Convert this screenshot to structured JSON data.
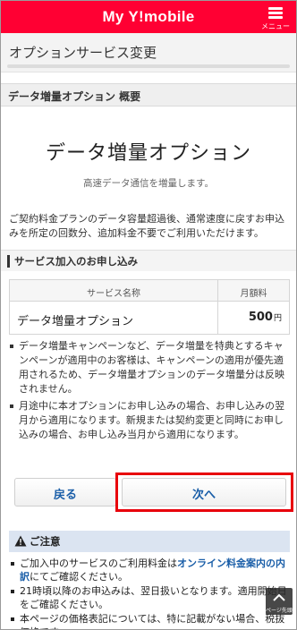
{
  "header": {
    "logo": "My Y!mobile",
    "menu_label": "メニュー"
  },
  "page": {
    "title": "オプションサービス変更"
  },
  "section": {
    "title": "データ増量オプション 概要"
  },
  "option": {
    "name": "データ増量オプション",
    "tagline": "高速データ通信を増量します。",
    "description": "ご契約料金プランのデータ容量超過後、通常速度に戻すお申込みを所定の回数分、追加料金不要でご利用いただけます。"
  },
  "application": {
    "title": "サービス加入のお申し込み",
    "table": {
      "headers": [
        "サービス名称",
        "月額料"
      ],
      "row": {
        "name": "データ増量オプション",
        "price": "500",
        "unit": "円"
      }
    }
  },
  "notes": [
    "データ増量キャンペーンなど、データ増量を特典とするキャンペーンが適用中のお客様は、キャンペーンの適用が優先適用されるため、データ増量オプションのデータ増量分は反映されません。",
    "月途中に本オプションにお申し込みの場合、お申し込みの翌月から適用になります。新規または契約変更と同時にお申し込みの場合、お申し込み当月から適用になります。"
  ],
  "buttons": {
    "back": "戻る",
    "next": "次へ"
  },
  "caution": {
    "title": "ご注意",
    "item1_before": "ご加入中のサービスのご利用料金は",
    "item1_link": "オンライン料金案内の内訳",
    "item1_after": "にてご確認ください。",
    "item2": "21時頃以降のお申込みは、翌日扱いとなります。適用開始日をご確認ください。",
    "item3": "本ページの価格表記については、特に記載がない場合、税抜価格です。"
  },
  "pagetop_label": "ページ先頭",
  "colors": {
    "brand": "#ff0033",
    "highlight_border": "#e8000b",
    "link": "#1a5ea8",
    "caution_bg": "#dbe4f1"
  }
}
